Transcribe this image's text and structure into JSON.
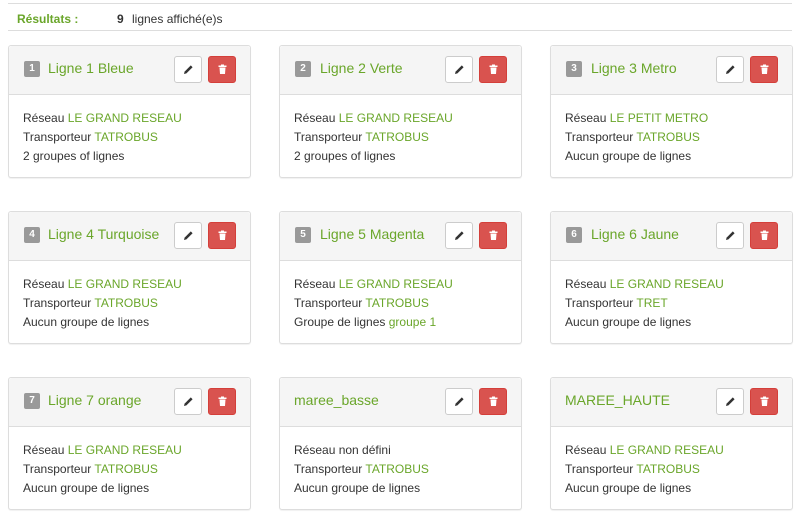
{
  "results": {
    "label": "Résultats :",
    "count": "9",
    "text": "lignes affiché(e)s"
  },
  "colors": {
    "accent": "#6aa62a",
    "danger": "#d9534f",
    "badge": "#999999"
  },
  "labels": {
    "network": "Réseau",
    "carrier": "Transporteur",
    "group": "Groupe de lignes"
  },
  "icons": {
    "edit": "pencil-icon",
    "delete": "trash-icon"
  },
  "cards": [
    {
      "number": "1",
      "title": "Ligne 1 Bleue",
      "network": "LE GRAND RESEAU",
      "carrier": "TATROBUS",
      "groups": "2 groupes of lignes"
    },
    {
      "number": "2",
      "title": "Ligne 2 Verte",
      "network": "LE GRAND RESEAU",
      "carrier": "TATROBUS",
      "groups": "2 groupes of lignes"
    },
    {
      "number": "3",
      "title": "Ligne 3 Metro",
      "network": "LE PETIT METRO",
      "carrier": "TATROBUS",
      "groups": "Aucun groupe de lignes"
    },
    {
      "number": "4",
      "title": "Ligne 4 Turquoise",
      "network": "LE GRAND RESEAU",
      "carrier": "TATROBUS",
      "groups": "Aucun groupe de lignes"
    },
    {
      "number": "5",
      "title": "Ligne 5 Magenta",
      "network": "LE GRAND RESEAU",
      "carrier": "TATROBUS",
      "group_value": "groupe 1"
    },
    {
      "number": "6",
      "title": "Ligne 6 Jaune",
      "network": "LE GRAND RESEAU",
      "carrier": "TRET",
      "groups": "Aucun groupe de lignes"
    },
    {
      "number": "7",
      "title": "Ligne 7 orange",
      "network": "LE GRAND RESEAU",
      "carrier": "TATROBUS",
      "groups": "Aucun groupe de lignes"
    },
    {
      "title": "maree_basse",
      "network_text": "Réseau non défini",
      "carrier": "TATROBUS",
      "groups": "Aucun groupe de lignes"
    },
    {
      "title": "MAREE_HAUTE",
      "network": "LE GRAND RESEAU",
      "carrier": "TATROBUS",
      "groups": "Aucun groupe de lignes"
    }
  ]
}
